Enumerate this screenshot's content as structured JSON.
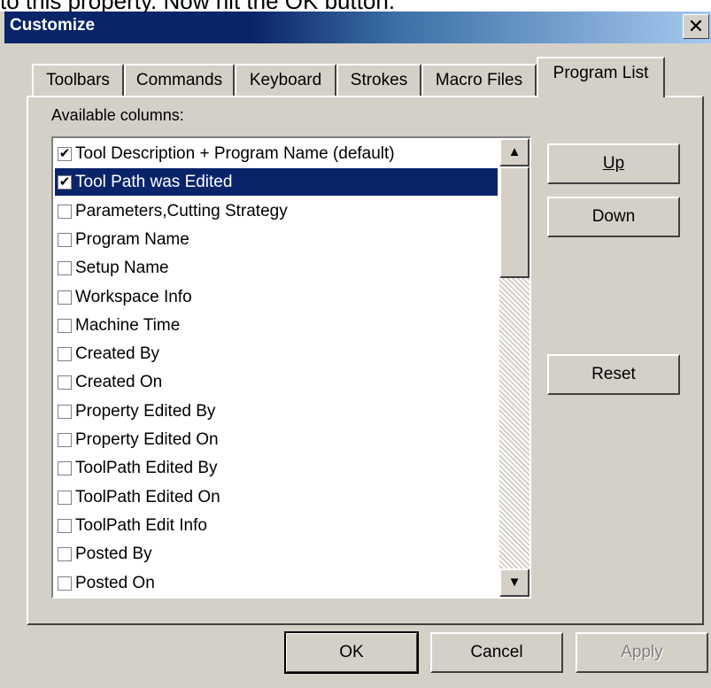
{
  "caption_snippet": "to this property. Now hit the OK button.",
  "dialog": {
    "title": "Customize",
    "close_glyph": "✕"
  },
  "tabs": [
    {
      "label": "Toolbars",
      "active": false
    },
    {
      "label": "Commands",
      "active": false
    },
    {
      "label": "Keyboard",
      "active": false
    },
    {
      "label": "Strokes",
      "active": false
    },
    {
      "label": "Macro Files",
      "active": false
    },
    {
      "label": "Program List",
      "active": true
    }
  ],
  "available_columns_label": "Available columns:",
  "columns": [
    {
      "label": "Tool Description + Program Name (default)",
      "checked": true,
      "selected": false
    },
    {
      "label": "Tool Path was Edited",
      "checked": true,
      "selected": true
    },
    {
      "label": "Parameters,Cutting Strategy",
      "checked": false,
      "selected": false
    },
    {
      "label": "Program Name",
      "checked": false,
      "selected": false
    },
    {
      "label": "Setup Name",
      "checked": false,
      "selected": false
    },
    {
      "label": "Workspace Info",
      "checked": false,
      "selected": false
    },
    {
      "label": "Machine Time",
      "checked": false,
      "selected": false
    },
    {
      "label": "Created By",
      "checked": false,
      "selected": false
    },
    {
      "label": "Created On",
      "checked": false,
      "selected": false
    },
    {
      "label": "Property Edited By",
      "checked": false,
      "selected": false
    },
    {
      "label": "Property Edited On",
      "checked": false,
      "selected": false
    },
    {
      "label": "ToolPath Edited By",
      "checked": false,
      "selected": false
    },
    {
      "label": "ToolPath Edited On",
      "checked": false,
      "selected": false
    },
    {
      "label": "ToolPath Edit Info",
      "checked": false,
      "selected": false
    },
    {
      "label": "Posted By",
      "checked": false,
      "selected": false
    },
    {
      "label": "Posted On",
      "checked": false,
      "selected": false
    }
  ],
  "side_buttons": {
    "up": "Up",
    "down": "Down",
    "reset": "Reset"
  },
  "bottom_buttons": {
    "ok": "OK",
    "cancel": "Cancel",
    "apply": "Apply"
  },
  "colors": {
    "dialog_bg": "#d4d0c8",
    "selection": "#0a246a",
    "title_gradient_start": "#0a246a",
    "title_gradient_end": "#a6caf0"
  }
}
